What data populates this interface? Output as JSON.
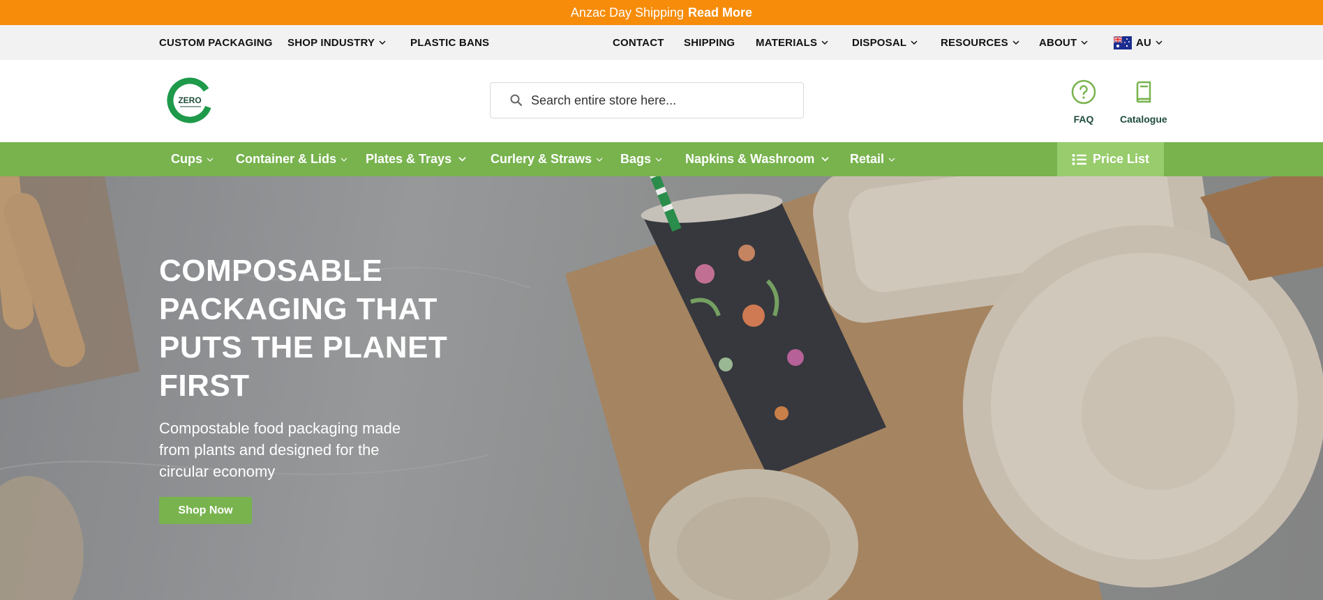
{
  "announcement": {
    "text": "Anzac Day Shipping",
    "link": "Read More"
  },
  "utility_nav": {
    "left": [
      {
        "label": "CUSTOM PACKAGING",
        "dropdown": false
      },
      {
        "label": "SHOP INDUSTRY",
        "dropdown": true
      },
      {
        "label": "PLASTIC BANS",
        "dropdown": false
      }
    ],
    "right": [
      {
        "label": "CONTACT",
        "dropdown": false
      },
      {
        "label": "SHIPPING",
        "dropdown": false
      },
      {
        "label": "MATERIALS",
        "dropdown": true
      },
      {
        "label": "DISPOSAL",
        "dropdown": true
      },
      {
        "label": "RESOURCES",
        "dropdown": true
      },
      {
        "label": "ABOUT",
        "dropdown": true
      }
    ],
    "region": {
      "label": "AU",
      "icon": "australia-flag-icon"
    }
  },
  "header": {
    "logo_text": "ZERO",
    "search": {
      "placeholder": "Search entire store here...",
      "value": ""
    },
    "faq_label": "FAQ",
    "catalogue_label": "Catalogue"
  },
  "category_nav": {
    "items": [
      {
        "label": "Cups"
      },
      {
        "label": "Container & Lids"
      },
      {
        "label": "Plates & Trays"
      },
      {
        "label": "Curlery & Straws"
      },
      {
        "label": "Bags"
      },
      {
        "label": "Napkins & Washroom"
      },
      {
        "label": "Retail"
      }
    ],
    "price_list": "Price List"
  },
  "hero": {
    "title": "COMPOSABLE PACKAGING THAT PUTS THE PLANET FIRST",
    "subtitle": "Compostable food packaging made from plants and designed for the circular economy",
    "button": "Shop Now"
  },
  "colors": {
    "announcement_bg": "#f78c0a",
    "utility_bg": "#f2f2f2",
    "nav_green": "#78b34e",
    "price_list_bg": "#98cc6c",
    "brand_dark_green": "#1f4d3a",
    "logo_green": "#1e9a4a"
  }
}
